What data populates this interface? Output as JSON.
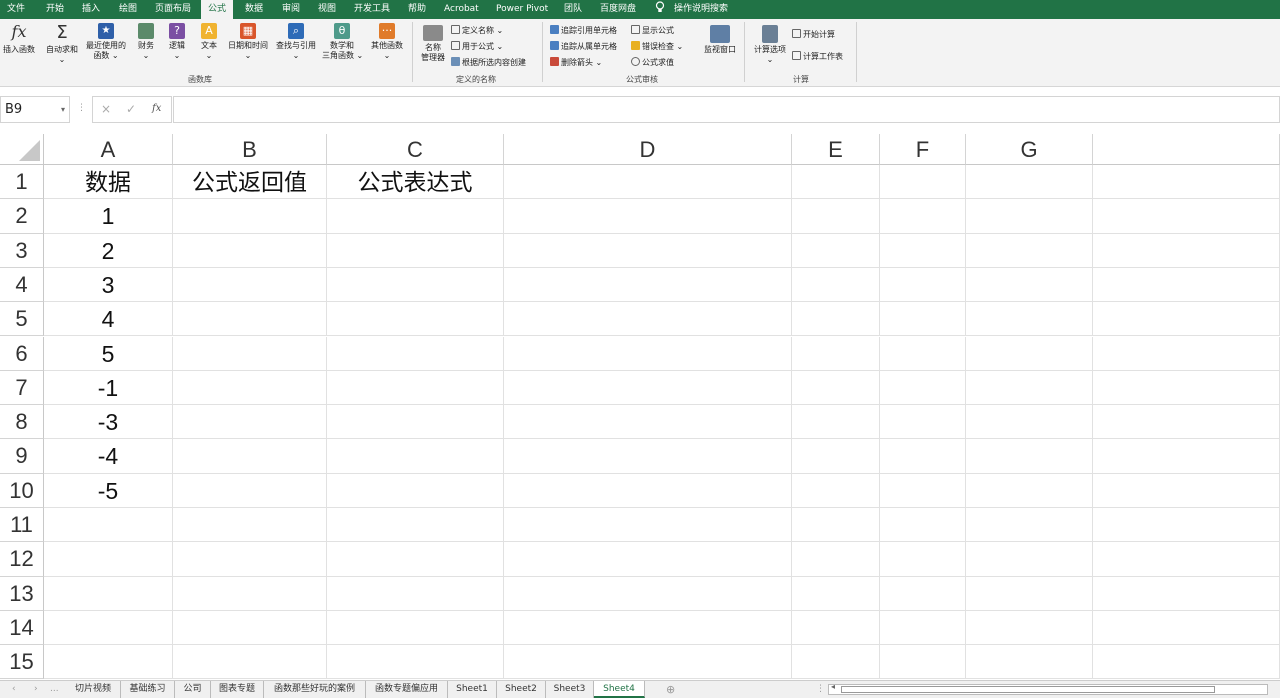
{
  "menu": {
    "tabs": [
      "文件",
      "开始",
      "插入",
      "绘图",
      "页面布局",
      "公式",
      "数据",
      "审阅",
      "视图",
      "开发工具",
      "帮助",
      "Acrobat",
      "Power Pivot",
      "团队",
      "百度网盘"
    ],
    "active": "公式",
    "search": "操作说明搜索"
  },
  "ribbon": {
    "insert_function": "插入函数",
    "autosum": "自动求和",
    "recent_1": "最近使用的",
    "recent_2": "函数",
    "financial": "财务",
    "logical": "逻辑",
    "text": "文本",
    "datetime": "日期和时间",
    "lookup": "查找与引用",
    "math_1": "数学和",
    "math_2": "三角函数",
    "other": "其他函数",
    "group_library": "函数库",
    "name_manager_1": "名称",
    "name_manager_2": "管理器",
    "define_name": "定义名称",
    "use_in_formula": "用于公式",
    "create_from_selection": "根据所选内容创建",
    "group_names": "定义的名称",
    "trace_precedents": "追踪引用单元格",
    "trace_dependents": "追踪从属单元格",
    "remove_arrows": "删除箭头",
    "show_formulas": "显示公式",
    "error_checking": "错误检查",
    "evaluate_formula": "公式求值",
    "watch_window": "监视窗口",
    "group_auditing": "公式审核",
    "calc_options": "计算选项",
    "calc_now": "开始计算",
    "calc_sheet": "计算工作表",
    "group_calc": "计算"
  },
  "formula_bar": {
    "name_box": "B9",
    "cancel": "×",
    "enter": "✓",
    "fx": "fx",
    "formula": ""
  },
  "columns": [
    "A",
    "B",
    "C",
    "D",
    "E",
    "F",
    "G"
  ],
  "rows": [
    "1",
    "2",
    "3",
    "4",
    "5",
    "6",
    "7",
    "8",
    "9",
    "10",
    "11",
    "12",
    "13",
    "14",
    "15"
  ],
  "cells": {
    "A1": "数据",
    "B1": "公式返回值",
    "C1": "公式表达式",
    "A2": "1",
    "A3": "2",
    "A4": "3",
    "A5": "4",
    "A6": "5",
    "A7": "-1",
    "A8": "-3",
    "A9": "-4",
    "A10": "-5"
  },
  "sheet_tabs": [
    "切片视频",
    "基础练习",
    "公司",
    "图表专题",
    "函数那些好玩的案例",
    "函数专题偏应用",
    "Sheet1",
    "Sheet2",
    "Sheet3",
    "Sheet4"
  ],
  "active_sheet": "Sheet4",
  "nav": {
    "prev": "‹",
    "next": "›",
    "dots": "...",
    "add": "⊕"
  }
}
